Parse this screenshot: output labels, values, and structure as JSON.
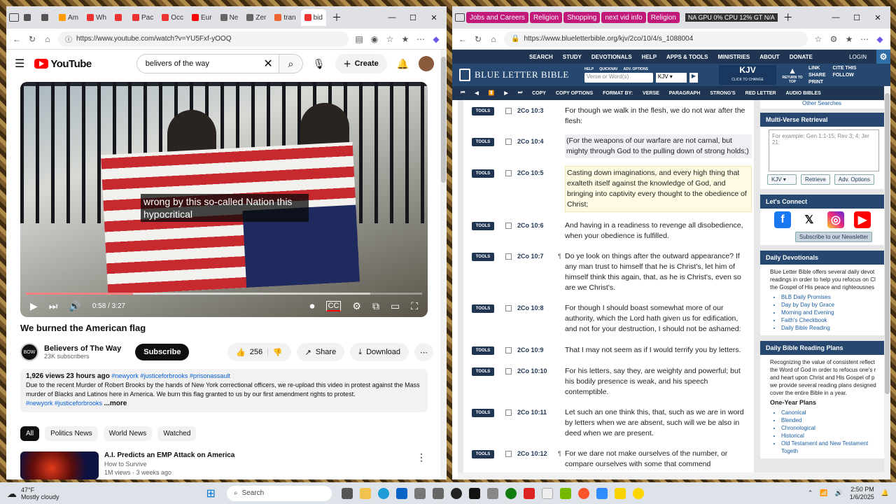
{
  "yt_browser": {
    "tabs": [
      {
        "label": "",
        "color": "#555"
      },
      {
        "label": "",
        "color": "#555"
      },
      {
        "label": "Am",
        "color": "#f90"
      },
      {
        "label": "Wh",
        "color": "#e33"
      },
      {
        "label": "",
        "color": "#e33"
      },
      {
        "label": "Pac",
        "color": "#e33"
      },
      {
        "label": "Occ",
        "color": "#e33"
      },
      {
        "label": "Eur",
        "color": "#f00"
      },
      {
        "label": "Ne",
        "color": "#666"
      },
      {
        "label": "Zer",
        "color": "#666"
      },
      {
        "label": "tran",
        "color": "#e63"
      },
      {
        "label": "bid",
        "color": "#e33"
      }
    ],
    "url": "https://www.youtube.com/watch?v=YU5Fxf-yOOQ"
  },
  "youtube": {
    "logo_text": "YouTube",
    "search_query": "belivers of the way",
    "create_label": "Create",
    "caption_text": "wrong by this so-called Nation this hypocritical",
    "progress_fraction": 0.27,
    "loaded_fraction": 0.87,
    "time_display": "0:58 / 3:27",
    "video_title": "We burned the American flag",
    "channel": {
      "name": "Believers of The Way",
      "subscribers": "23K subscribers",
      "avatar_text": "BOW"
    },
    "subscribe_label": "Subscribe",
    "likes": "256",
    "share_label": "Share",
    "download_label": "Download",
    "description": {
      "views": "1,926 views",
      "age": "23 hours ago",
      "hashtags": "#newyork #justiceforbrooks #prisonassault",
      "text": "Due to the recent Murder of Robert Brooks by the hands of New York correctional officers, we re-upload this video in protest against the Mass murder of Blacks and Latinos here in America. We burn this flag granted to us by our first amendment rights to protest.",
      "tags_line": "#newyork #justiceforbrooks",
      "more": "...more"
    },
    "chips": [
      "All",
      "Politics News",
      "World News",
      "Watched"
    ],
    "recommendation": {
      "title": "A.I. Predicts an EMP Attack on America",
      "channel": "How to Survive",
      "meta": "1M views · 3 weeks ago"
    }
  },
  "blb_browser": {
    "tabs": [
      {
        "label": "Jobs and Careers",
        "color": "#c2187a"
      },
      {
        "label": "Religion",
        "color": "#c2187a"
      },
      {
        "label": "Shopping",
        "color": "#c2187a"
      },
      {
        "label": "next vid info",
        "color": "#c2187a"
      },
      {
        "label": "Religion",
        "color": "#c2187a"
      }
    ],
    "overlay": "NA GPU 0% CPU 12% GT N/A",
    "url": "https://www.blueletterbible.org/kjv/2co/10/4/s_1088004"
  },
  "blb": {
    "menu": [
      "SEARCH",
      "STUDY",
      "DEVOTIONALS",
      "HELP",
      "APPS & TOOLS",
      "MINISTRIES",
      "ABOUT",
      "DONATE"
    ],
    "login": "LOGIN",
    "logo": "BLUE LETTER BIBLE",
    "mini_links": [
      "HELP",
      "QUICKNAV",
      "ADV. OPTIONS"
    ],
    "verse_placeholder": "Verse or Word(s)",
    "version": "KJV",
    "kjv_label": "KJV",
    "kjv_sub": "CLICK TO CHANGE",
    "return_top": "RETURN TO TOP",
    "right_buttons": [
      "LINK",
      "CITE THIS",
      "SHARE",
      "FOLLOW",
      "PRINT"
    ],
    "tools": [
      "COPY",
      "COPY OPTIONS",
      "FORMAT BY:",
      "VERSE",
      "PARAGRAPH",
      "STRONG'S",
      "RED LETTER",
      "AUDIO BIBLES"
    ],
    "other_searches": "Other Searches",
    "verses": [
      {
        "ref": "2Co 10:3",
        "para": "",
        "text": "For though we walk in the flesh, we do not war after the flesh:",
        "style": ""
      },
      {
        "ref": "2Co 10:4",
        "para": "",
        "text": "(For the weapons of our warfare are not carnal, but mighty through God to the pulling down of strong holds;)",
        "style": "sel"
      },
      {
        "ref": "2Co 10:5",
        "para": "",
        "text": "Casting down imaginations, and every high thing that exalteth itself against the knowledge of God, and bringing into captivity every thought to the obedience of Christ;",
        "style": "hl"
      },
      {
        "ref": "2Co 10:6",
        "para": "",
        "text": "And having in a readiness to revenge all disobedience, when your obedience is fulfilled.",
        "style": ""
      },
      {
        "ref": "2Co 10:7",
        "para": "¶",
        "text": "Do ye look on things after the outward appearance? If any man trust to himself that he is Christ's, let him of himself think this again, that, as he is Christ's, even so are we Christ's.",
        "style": ""
      },
      {
        "ref": "2Co 10:8",
        "para": "",
        "text": "For though I should boast somewhat more of our authority, which the Lord hath given us for edification, and not for your destruction, I should not be ashamed:",
        "style": ""
      },
      {
        "ref": "2Co 10:9",
        "para": "",
        "text": "That I may not seem as if I would terrify you by letters.",
        "style": ""
      },
      {
        "ref": "2Co 10:10",
        "para": "",
        "text": "For his letters, say they, are weighty and powerful; but his bodily presence is weak, and his speech contemptible.",
        "style": ""
      },
      {
        "ref": "2Co 10:11",
        "para": "",
        "text": "Let such an one think this, that, such as we are in word by letters when we are absent, such will we be also in deed when we are present.",
        "style": ""
      },
      {
        "ref": "2Co 10:12",
        "para": "¶",
        "text": "For we dare not make ourselves of the number, or compare ourselves with some that commend",
        "style": ""
      }
    ],
    "tools_label": "TOOLS",
    "mvr": {
      "title": "Multi-Verse Retrieval",
      "placeholder": "For example: Gen 1:1-15; Rev 3; 4; Jer 21:",
      "version": "KJV",
      "retrieve": "Retrieve",
      "adv": "Adv. Options"
    },
    "connect": {
      "title": "Let's Connect",
      "newsletter": "Subscribe to our Newsletter"
    },
    "devotionals": {
      "title": "Daily Devotionals",
      "text": "Blue Letter Bible offers several daily devot readings in order to help you refocus on Cl the Gospel of His peace and righteousnes",
      "items": [
        "BLB Daily Promises",
        "Day by Day by Grace",
        "Morning and Evening",
        "Faith's Checkbook",
        "Daily Bible Reading"
      ]
    },
    "plans": {
      "title": "Daily Bible Reading Plans",
      "text": "Recognizing the value of consistent reflect the Word of God in order to refocus one's r and heart upon Christ and His Gospel of p we provide several reading plans designed cover the entire Bible in a year.",
      "subtitle": "One-Year Plans",
      "items": [
        "Canonical",
        "Blended",
        "Chronological",
        "Historical",
        "Old Testament and New Testament Togeth"
      ]
    }
  },
  "taskbar": {
    "temp": "47°F",
    "weather": "Mostly cloudy",
    "search": "Search",
    "time": "2:50 PM",
    "date": "1/6/2025"
  }
}
